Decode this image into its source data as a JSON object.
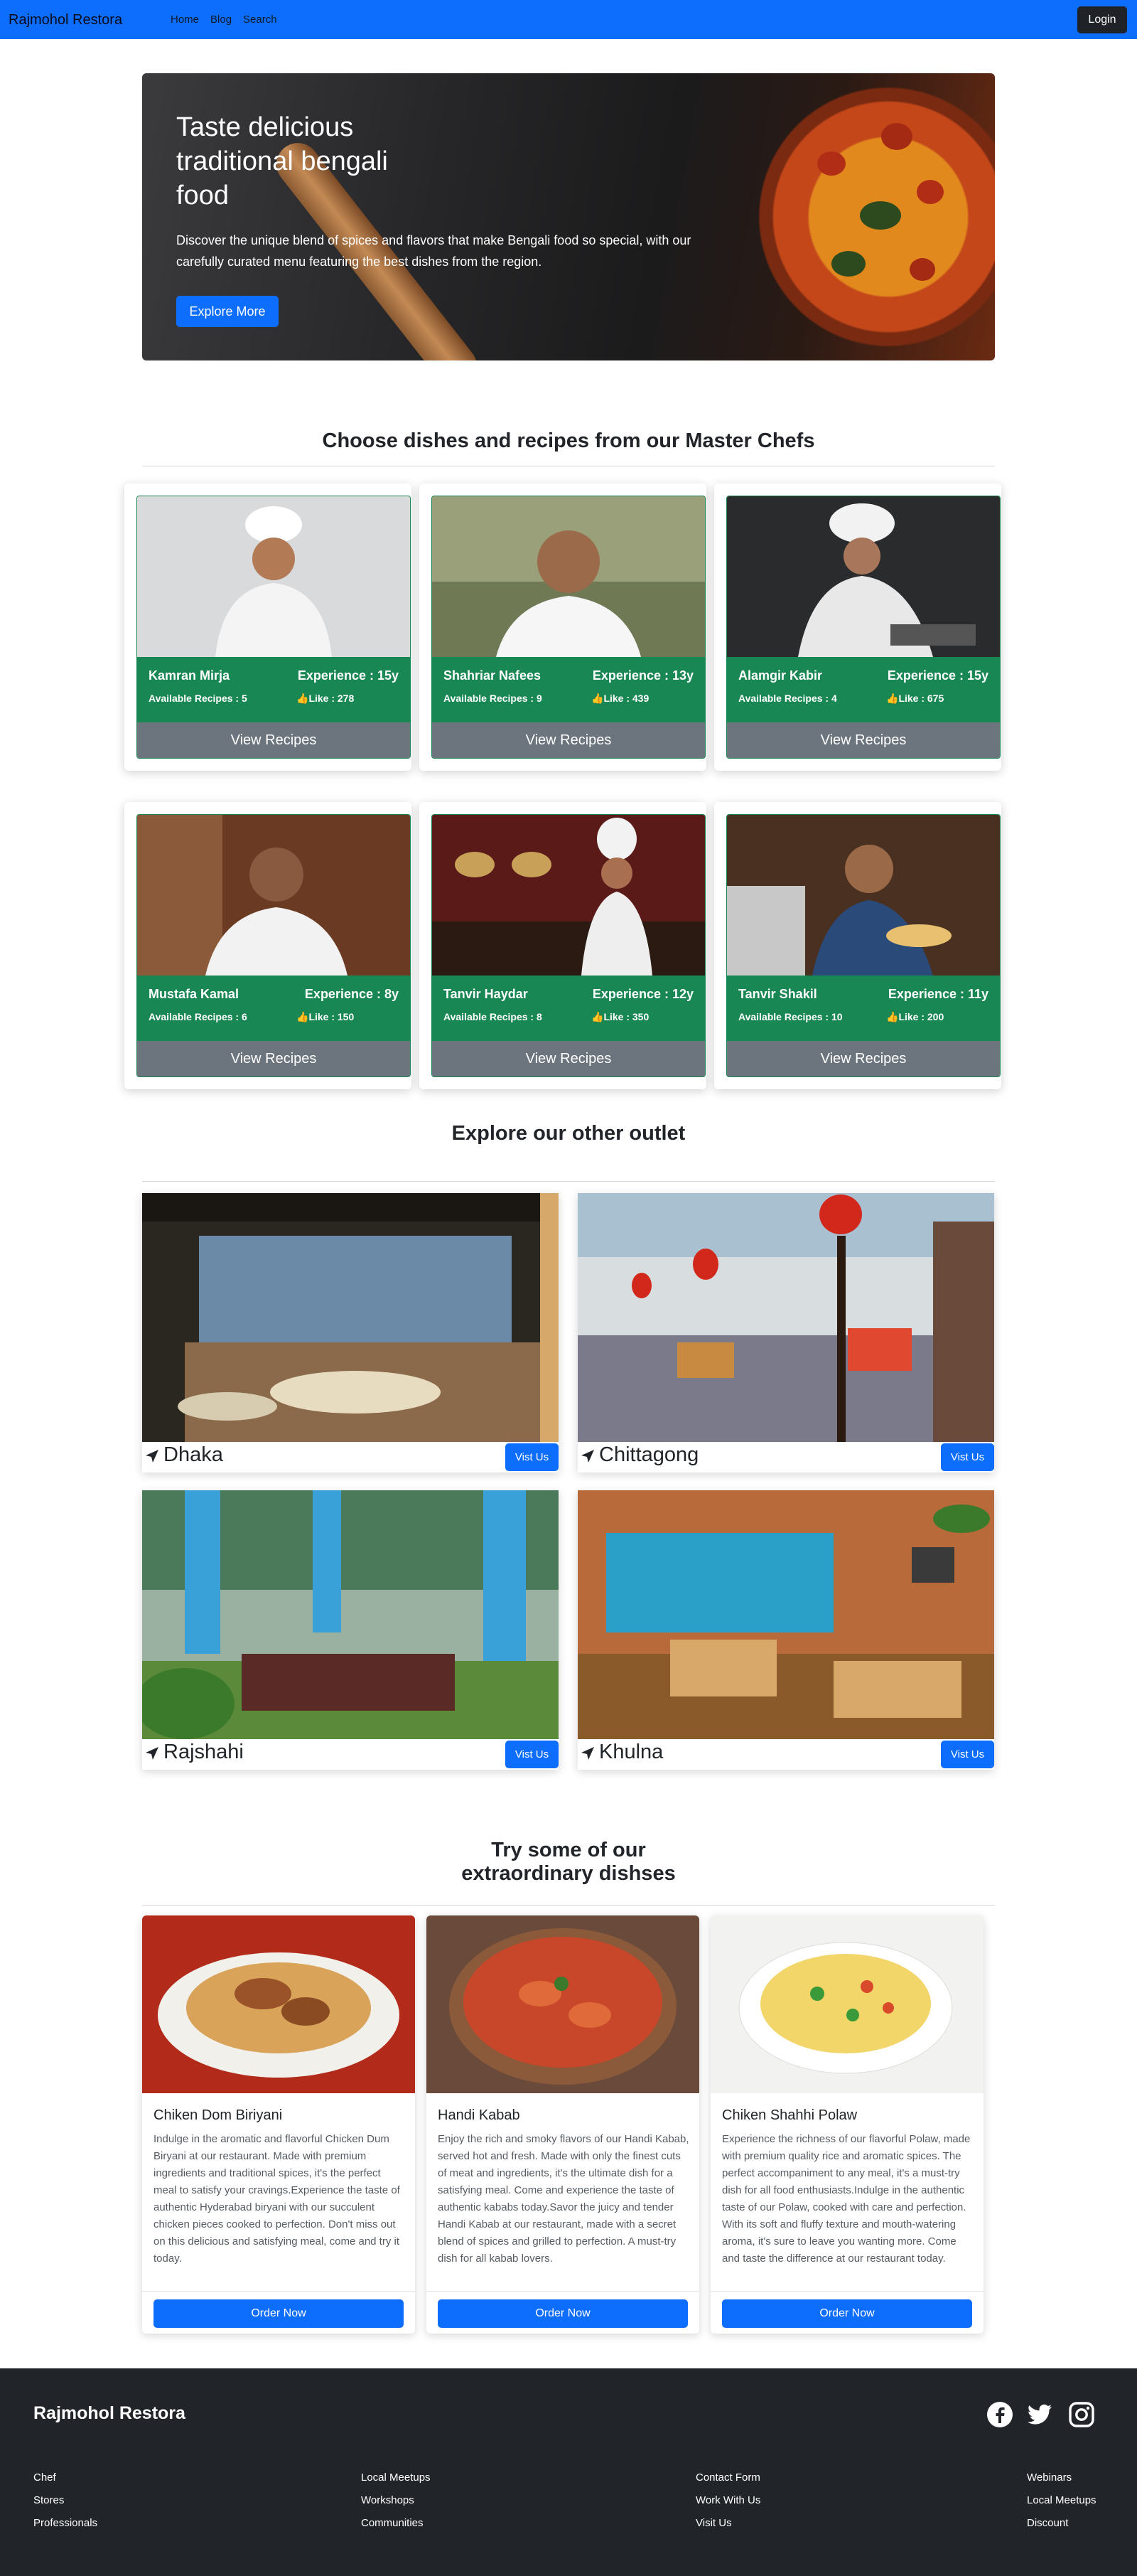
{
  "navbar": {
    "brand": "Rajmohol Restora",
    "links": [
      "Home",
      "Blog",
      "Search"
    ],
    "login": "Login"
  },
  "hero": {
    "title": "Taste delicious traditional bengali food",
    "text": "Discover the unique blend of spices and flavors that make Bengali food so special, with our carefully curated menu featuring the best dishes from the region.",
    "button": "Explore More"
  },
  "chefs_section": {
    "title": "Choose dishes and recipes from our Master Chefs",
    "chefs": [
      {
        "name": "Kamran Mirja",
        "experience": "Experience : 15y",
        "recipes": "Available Recipes : 5",
        "likes": "Like : 278",
        "button": "View Recipes"
      },
      {
        "name": "Shahriar Nafees",
        "experience": "Experience : 13y",
        "recipes": "Available Recipes : 9",
        "likes": "Like : 439",
        "button": "View Recipes"
      },
      {
        "name": "Alamgir Kabir",
        "experience": "Experience : 15y",
        "recipes": "Available Recipes : 4",
        "likes": "Like : 675",
        "button": "View Recipes"
      },
      {
        "name": "Mustafa Kamal",
        "experience": "Experience : 8y",
        "recipes": "Available Recipes : 6",
        "likes": "Like : 150",
        "button": "View Recipes"
      },
      {
        "name": "Tanvir Haydar",
        "experience": "Experience : 12y",
        "recipes": "Available Recipes : 8",
        "likes": "Like : 350",
        "button": "View Recipes"
      },
      {
        "name": "Tanvir Shakil",
        "experience": "Experience : 11y",
        "recipes": "Available Recipes : 10",
        "likes": "Like : 200",
        "button": "View Recipes"
      }
    ]
  },
  "outlets_section": {
    "title": "Explore our other outlet",
    "outlets": [
      {
        "name": "Dhaka",
        "button": "Vist Us"
      },
      {
        "name": "Chittagong",
        "button": "Vist Us"
      },
      {
        "name": "Rajshahi",
        "button": "Vist Us"
      },
      {
        "name": "Khulna",
        "button": "Vist Us"
      }
    ]
  },
  "dishes_section": {
    "title_line1": "Try some of our",
    "title_line2": "extraordinary dishses",
    "dishes": [
      {
        "name": "Chiken Dom Biriyani",
        "description": "Indulge in the aromatic and flavorful Chicken Dum Biryani at our restaurant. Made with premium ingredients and traditional spices, it's the perfect meal to satisfy your cravings.Experience the taste of authentic Hyderabad biryani with our succulent chicken pieces cooked to perfection. Don't miss out on this delicious and satisfying meal, come and try it today.",
        "button": "Order Now"
      },
      {
        "name": "Handi Kabab",
        "description": "Enjoy the rich and smoky flavors of our Handi Kabab, served hot and fresh. Made with only the finest cuts of meat and ingredients, it's the ultimate dish for a satisfying meal. Come and experience the taste of authentic kababs today.Savor the juicy and tender Handi Kabab at our restaurant, made with a secret blend of spices and grilled to perfection. A must-try dish for all kabab lovers.",
        "button": "Order Now"
      },
      {
        "name": "Chiken Shahhi Polaw",
        "description": "Experience the richness of our flavorful Polaw, made with premium quality rice and aromatic spices. The perfect accompaniment to any meal, it's a must-try dish for all food enthusiasts.Indulge in the authentic taste of our Polaw, cooked with care and perfection. With its soft and fluffy texture and mouth-watering aroma, it's sure to leave you wanting more. Come and taste the difference at our restaurant today.",
        "button": "Order Now"
      }
    ]
  },
  "footer": {
    "brand": "Rajmohol Restora",
    "social": [
      "facebook-icon",
      "twitter-icon",
      "instagram-icon"
    ],
    "col1": [
      "Chef",
      "Stores",
      "Professionals"
    ],
    "col2": [
      "Local Meetups",
      "Workshops",
      "Communities"
    ],
    "col3": [
      "Contact Form",
      "Work With Us",
      "Visit Us"
    ],
    "col4": [
      "Webinars",
      "Local Meetups",
      "Discount"
    ]
  },
  "colors": {
    "primary": "#0d6efd",
    "chef_green": "#198754",
    "secondary": "#6c757d",
    "dark": "#212529"
  }
}
